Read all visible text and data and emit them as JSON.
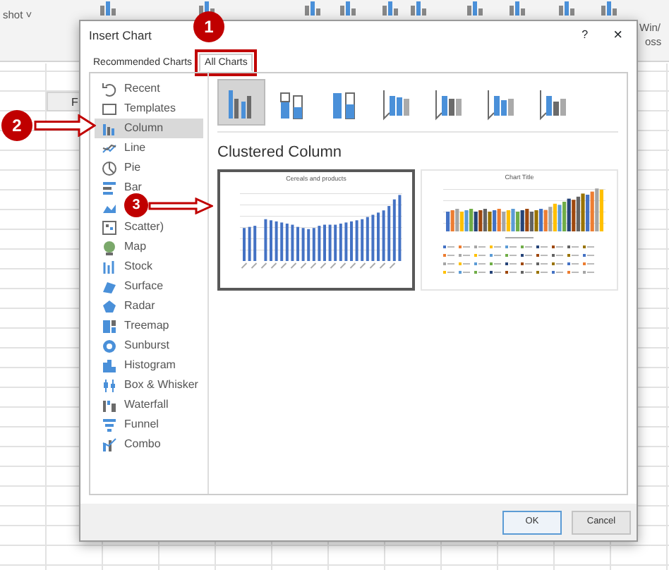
{
  "ribbon": {
    "left_label": "shot ˅",
    "right_label_top": "Win/",
    "right_label_bottom": "oss"
  },
  "sheet": {
    "column_header": "F"
  },
  "dialog": {
    "title": "Insert Chart",
    "help": "?",
    "close": "×",
    "tabs": [
      {
        "label": "Recommended Charts",
        "selected": false,
        "annotated": false
      },
      {
        "label": "All Charts",
        "selected": true,
        "annotated": true
      }
    ],
    "chart_types": [
      {
        "label": "Recent",
        "selected": false
      },
      {
        "label": "Templates",
        "selected": false
      },
      {
        "label": "Column",
        "selected": true
      },
      {
        "label": "Line",
        "selected": false
      },
      {
        "label": "Pie",
        "selected": false
      },
      {
        "label": "Bar",
        "selected": false
      },
      {
        "selected": false
      },
      {
        "label": "Scatter)",
        "selected": false
      },
      {
        "label": "Map",
        "selected": false
      },
      {
        "label": "Stock",
        "selected": false
      },
      {
        "label": "Surface",
        "selected": false
      },
      {
        "label": "Radar",
        "selected": false
      },
      {
        "label": "Treemap",
        "selected": false
      },
      {
        "label": "Sunburst",
        "selected": false
      },
      {
        "label": "Histogram",
        "selected": false
      },
      {
        "label": "Box & Whisker",
        "selected": false
      },
      {
        "label": "Waterfall",
        "selected": false
      },
      {
        "label": "Funnel",
        "selected": false
      },
      {
        "label": "Combo",
        "selected": false
      }
    ],
    "subtypes": [
      {
        "selected": true
      },
      {
        "selected": false
      },
      {
        "selected": false
      },
      {
        "selected": false
      },
      {
        "selected": false
      },
      {
        "selected": false
      },
      {
        "selected": false
      }
    ],
    "subtype_title": "Clustered Column",
    "previews": [
      {
        "title": "Cereals and products",
        "selected": true,
        "kind": "single"
      },
      {
        "title": "Chart Title",
        "selected": false,
        "kind": "multi"
      }
    ],
    "buttons": [
      {
        "label": "OK",
        "default": true
      },
      {
        "label": "Cancel",
        "default": false
      }
    ]
  },
  "callouts": [
    {
      "number": "1"
    },
    {
      "number": "2"
    },
    {
      "number": "3"
    }
  ]
}
